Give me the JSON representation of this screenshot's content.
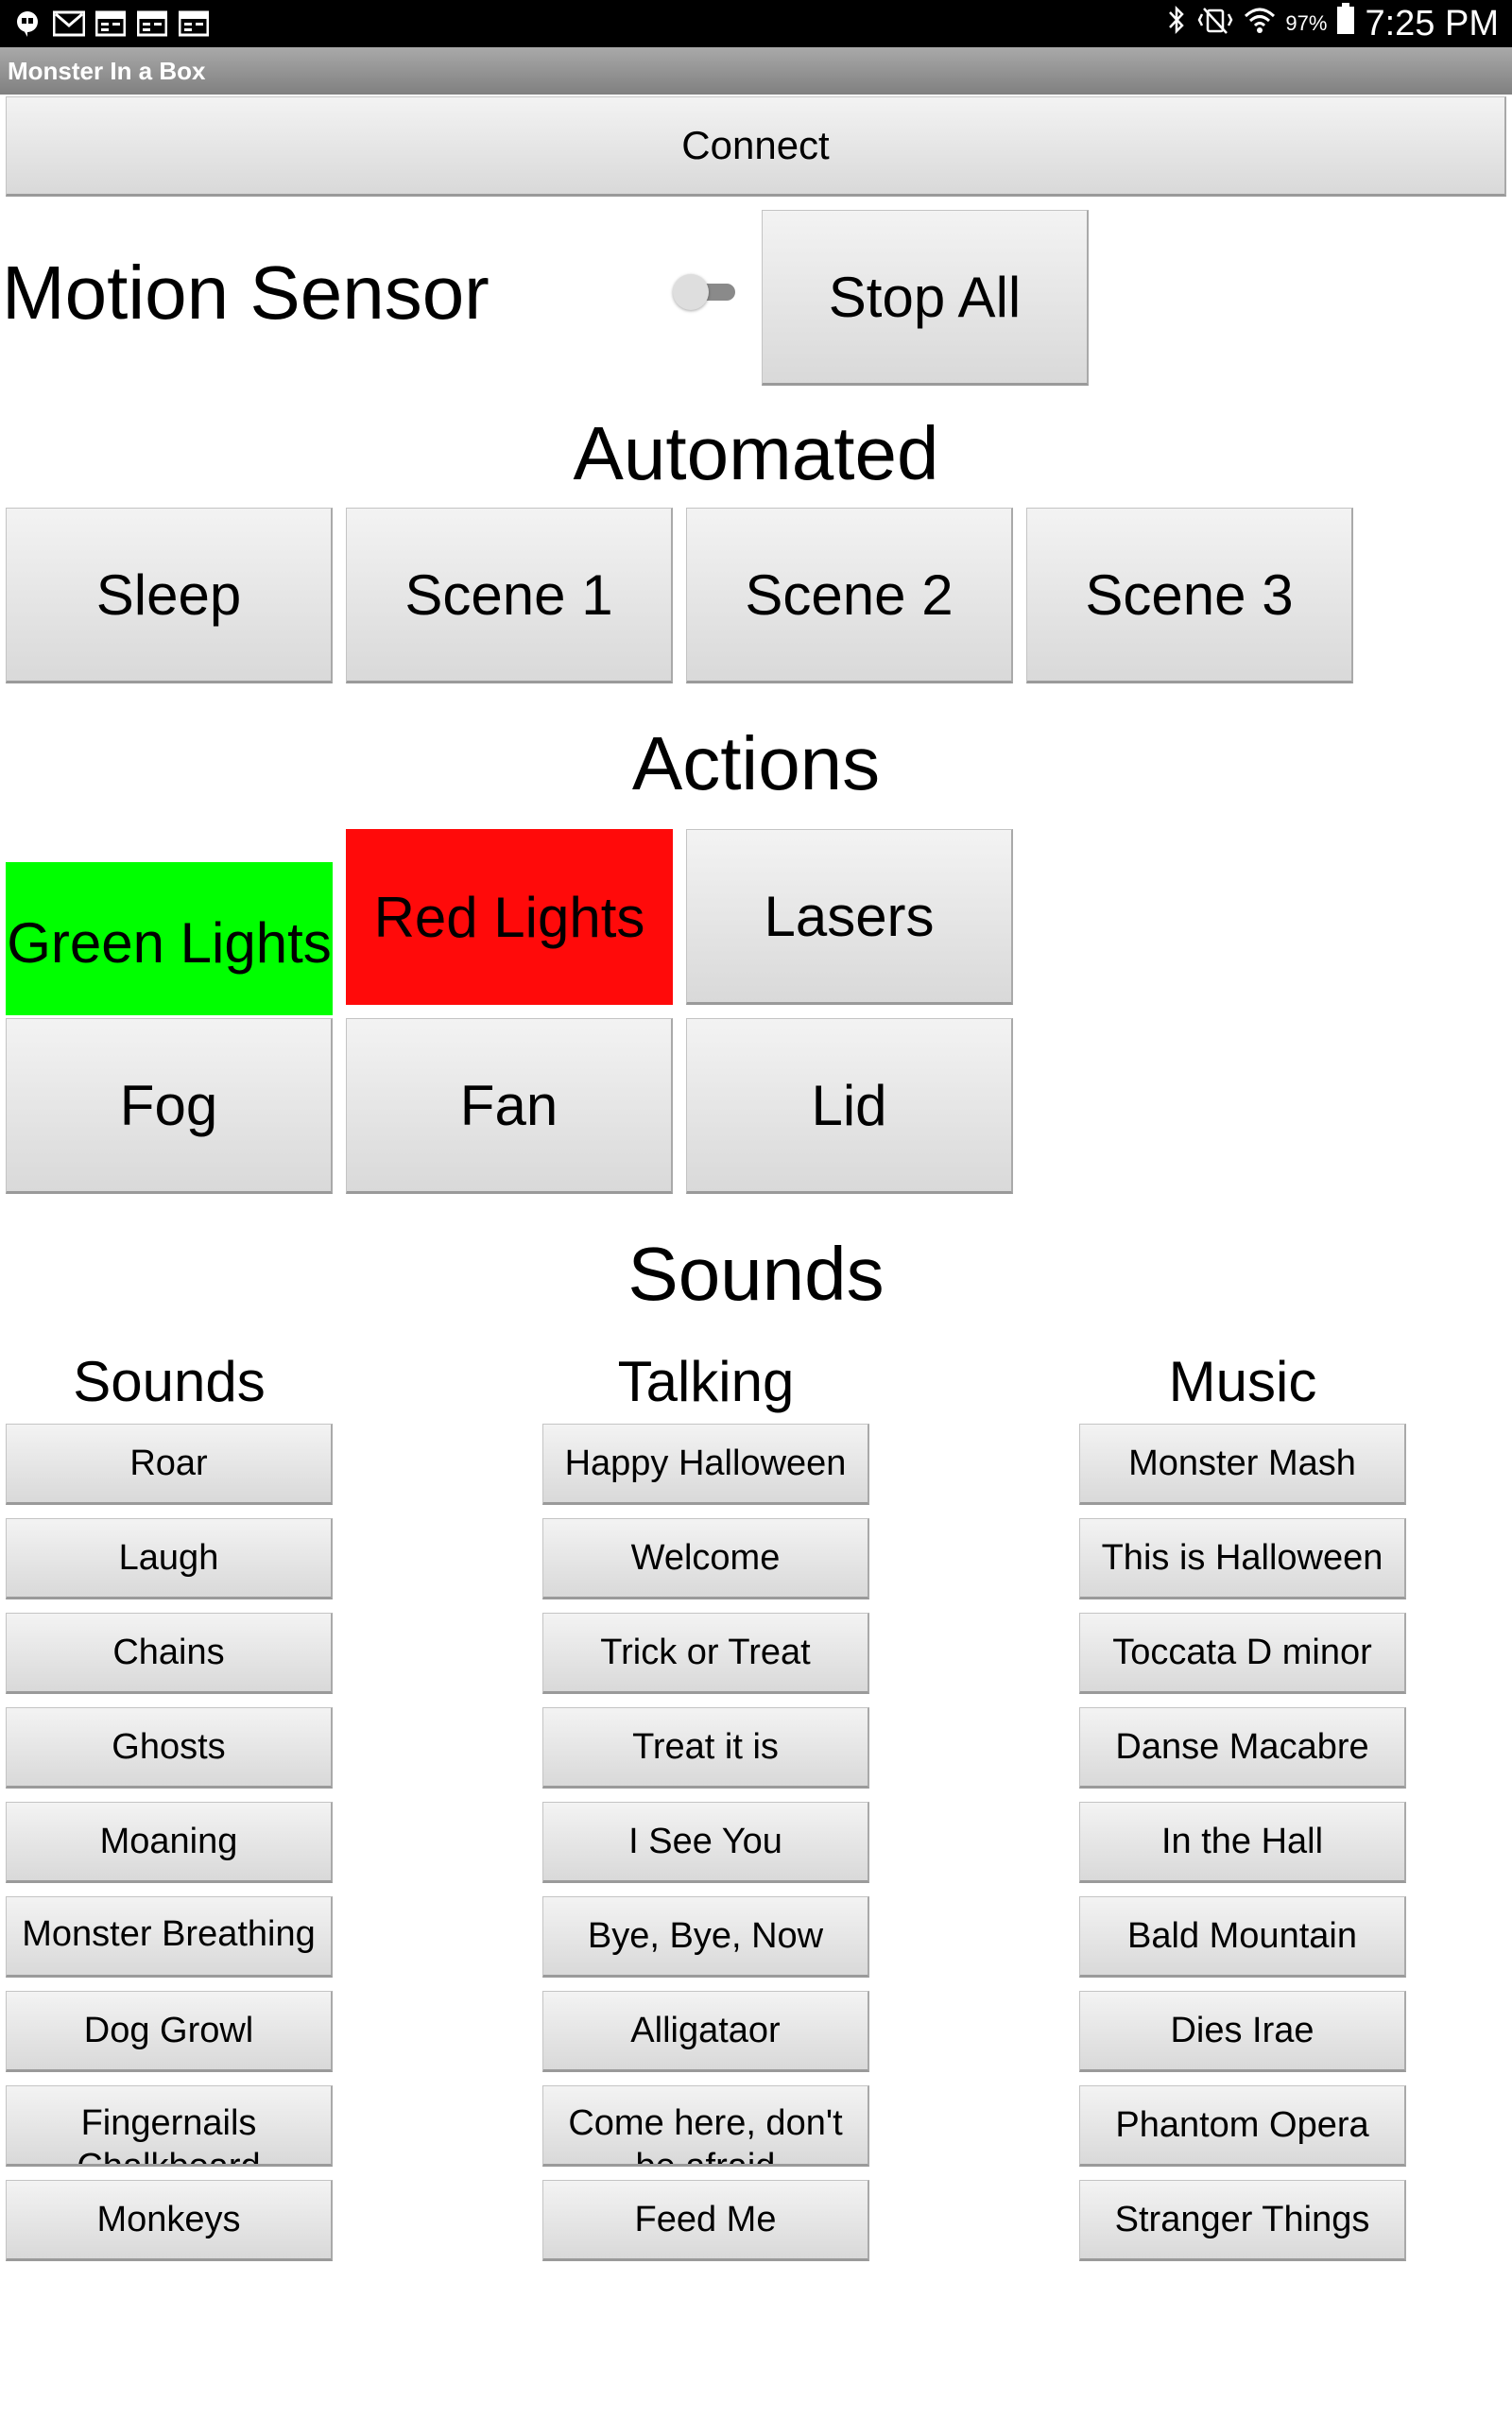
{
  "status_bar": {
    "left_icons": [
      "hangouts-icon",
      "gmail-icon",
      "calendar-icon",
      "calendar-icon",
      "calendar-icon"
    ],
    "battery_percent": "97%",
    "time": "7:25 PM"
  },
  "app": {
    "title": "Monster In a Box"
  },
  "connect_label": "Connect",
  "motion": {
    "label": "Motion Sensor",
    "toggle_on": false
  },
  "stop_all_label": "Stop All",
  "automated": {
    "heading": "Automated",
    "buttons": [
      "Sleep",
      "Scene 1",
      "Scene 2",
      "Scene 3"
    ]
  },
  "actions": {
    "heading": "Actions",
    "green_lights": "Green Lights",
    "red_lights": "Red Lights",
    "lasers": "Lasers",
    "fog": "Fog",
    "fan": "Fan",
    "lid": "Lid",
    "colors": {
      "green": "#00ff00",
      "red": "#ff0a0a"
    }
  },
  "sounds_section": {
    "heading": "Sounds",
    "columns": [
      {
        "header": "Sounds",
        "items": [
          "Roar",
          "Laugh",
          "Chains",
          "Ghosts",
          "Moaning",
          "Monster Breathing",
          "Dog Growl",
          "Fingernails Chalkboard",
          "Monkeys"
        ]
      },
      {
        "header": "Talking",
        "items": [
          "Happy Halloween",
          "Welcome",
          "Trick or Treat",
          "Treat it is",
          "I See You",
          "Bye, Bye, Now",
          "Alligataor",
          "Come here, don't be afraid",
          "Feed Me"
        ]
      },
      {
        "header": "Music",
        "items": [
          "Monster Mash",
          "This is Halloween",
          "Toccata D minor",
          "Danse Macabre",
          "In the Hall",
          "Bald Mountain",
          "Dies Irae",
          "Phantom Opera",
          "Stranger Things"
        ]
      }
    ]
  }
}
